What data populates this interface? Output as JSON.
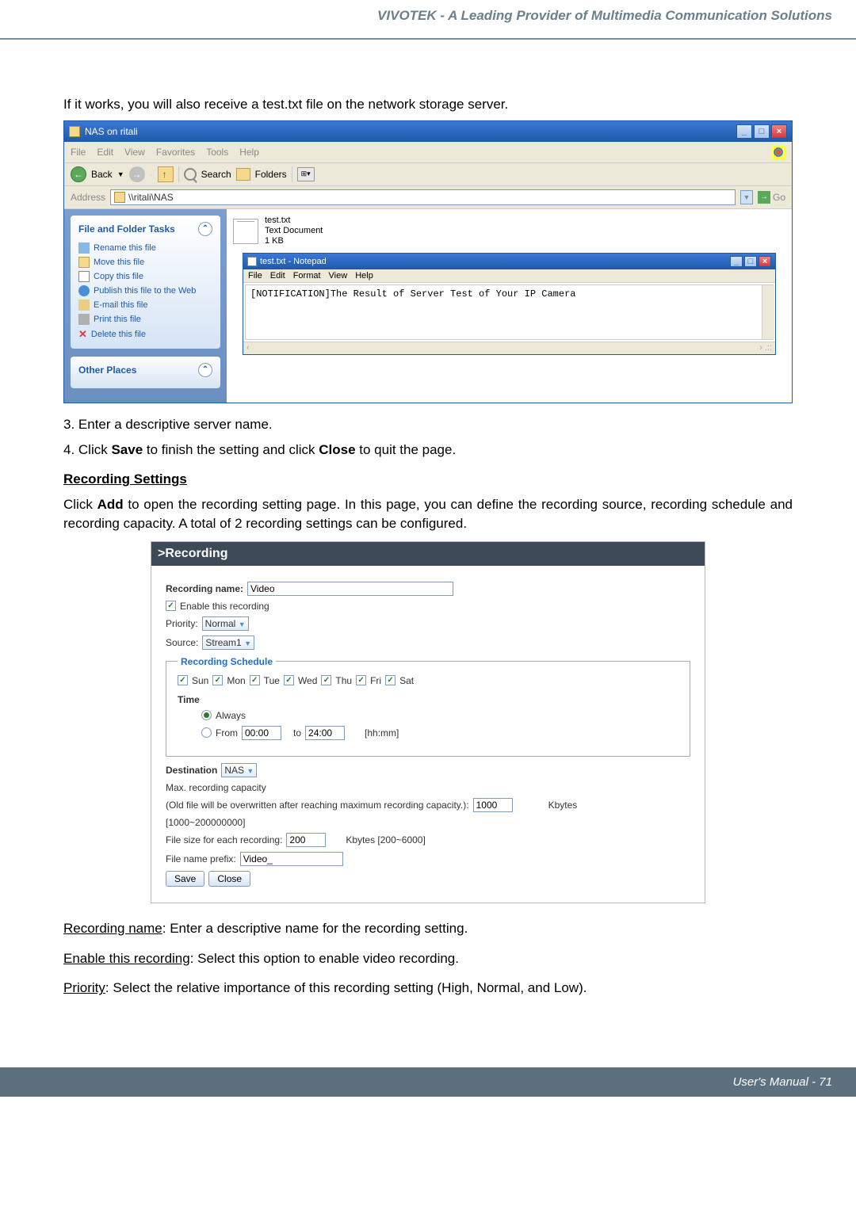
{
  "header_banner": "VIVOTEK - A Leading Provider of Multimedia Communication Solutions",
  "intro_text": "If it works, you will also receive a test.txt file on the network storage server.",
  "explorer": {
    "title": "NAS on ritali",
    "menu": [
      "File",
      "Edit",
      "View",
      "Favorites",
      "Tools",
      "Help"
    ],
    "toolbar": {
      "back": "Back",
      "search": "Search",
      "folders": "Folders"
    },
    "address_label": "Address",
    "address_value": "\\\\ritali\\NAS",
    "go_label": "Go",
    "sidebar": {
      "panel1_title": "File and Folder Tasks",
      "tasks": [
        "Rename this file",
        "Move this file",
        "Copy this file",
        "Publish this file to the Web",
        "E-mail this file",
        "Print this file",
        "Delete this file"
      ],
      "panel2_title": "Other Places"
    },
    "file": {
      "name": "test.txt",
      "type": "Text Document",
      "size": "1 KB"
    },
    "notepad": {
      "title": "test.txt - Notepad",
      "menu": [
        "File",
        "Edit",
        "Format",
        "View",
        "Help"
      ],
      "content": "[NOTIFICATION]The Result of Server Test of Your IP Camera"
    }
  },
  "steps": {
    "s3": "3. Enter a descriptive server name.",
    "s4_prefix": "4. Click ",
    "s4_save": "Save",
    "s4_mid": " to finish the setting and click ",
    "s4_close": "Close",
    "s4_suffix": " to quit the page."
  },
  "recording_settings": {
    "heading": "Recording Settings",
    "desc_prefix": "Click ",
    "desc_add": "Add",
    "desc_suffix": " to open the recording setting page. In this page, you can define the recording source, recording schedule and recording capacity. A total of 2 recording settings can be configured."
  },
  "rec_panel": {
    "header": ">Recording",
    "name_label": "Recording name:",
    "name_value": "Video",
    "enable_label": "Enable this recording",
    "priority_label": "Priority:",
    "priority_value": "Normal",
    "source_label": "Source:",
    "source_value": "Stream1",
    "schedule_legend": "Recording Schedule",
    "days": [
      "Sun",
      "Mon",
      "Tue",
      "Wed",
      "Thu",
      "Fri",
      "Sat"
    ],
    "time_label": "Time",
    "always_label": "Always",
    "from_label": "From",
    "from_value": "00:00",
    "to_label": "to",
    "to_value": "24:00",
    "hhmm": "[hh:mm]",
    "dest_label": "Destination",
    "dest_value": "NAS",
    "max_cap_label": "Max. recording capacity",
    "overwrite_label": "(Old file will be overwritten after reaching maximum recording capacity.):",
    "overwrite_value": "1000",
    "kbytes": "Kbytes",
    "range_cap": "[1000~200000000]",
    "filesize_label": "File size for each recording:",
    "filesize_value": "200",
    "filesize_range": "Kbytes [200~6000]",
    "prefix_label": "File name prefix:",
    "prefix_value": "Video_",
    "save_btn": "Save",
    "close_btn": "Close"
  },
  "defs": {
    "rec_name_label": "Recording name",
    "rec_name_text": ": Enter a descriptive name for the recording setting.",
    "enable_label": "Enable this recording",
    "enable_text": ": Select this option to enable video recording.",
    "priority_label": "Priority",
    "priority_text": ": Select the relative importance of this recording setting (High, Normal, and Low)."
  },
  "footer": "User's Manual - 71"
}
